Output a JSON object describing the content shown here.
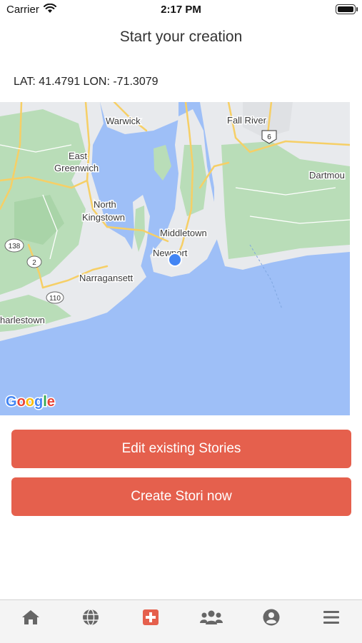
{
  "status_bar": {
    "carrier": "Carrier",
    "time": "2:17 PM"
  },
  "header": {
    "title": "Start your creation"
  },
  "location": {
    "coords_text": "LAT: 41.4791 LON: -71.3079"
  },
  "map": {
    "labels": {
      "warwick": "Warwick",
      "fall_river": "Fall River",
      "east": "East",
      "greenwich": "Greenwich",
      "dartmouth": "Dartmou",
      "north": "North",
      "kingstown": "Kingstown",
      "middletown": "Middletown",
      "newport": "Newport",
      "narragansett": "Narragansett",
      "charlestown": "harlestown",
      "route_138": "138",
      "route_2": "2",
      "route_110": "110",
      "route_6": "6"
    },
    "logo": {
      "G": "G",
      "o1": "o",
      "o2": "o",
      "g": "g",
      "l": "l",
      "e": "e"
    },
    "colors": {
      "water": "#9ebff7",
      "land": "#e8eaed",
      "green": "#b9ddb8",
      "road": "#f6cf66",
      "marker": "#4285f4"
    }
  },
  "buttons": {
    "edit_label": "Edit existing Stories",
    "create_label": "Create Stori now"
  },
  "tab_bar": {
    "active_color": "#e5604d",
    "inactive_color": "#666666",
    "items": [
      "home-icon",
      "globe-icon",
      "add-icon",
      "community-icon",
      "profile-icon",
      "menu-icon"
    ]
  }
}
